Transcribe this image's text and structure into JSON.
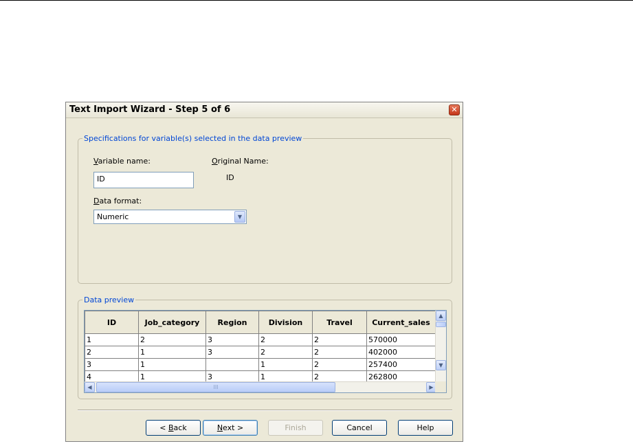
{
  "dialog": {
    "title": "Text Import Wizard - Step 5 of 6",
    "close_glyph": "✕"
  },
  "spec": {
    "legend": "Specifications for variable(s) selected in the data preview",
    "variable_name_label_prefix": "",
    "variable_name_label_u": "V",
    "variable_name_label_rest": "ariable name:",
    "variable_name_value": "ID",
    "original_name_label_u": "O",
    "original_name_label_rest": "riginal Name:",
    "original_name_value": "ID",
    "data_format_label_u": "D",
    "data_format_label_rest": "ata format:",
    "data_format_value": "Numeric"
  },
  "preview": {
    "legend": "Data preview",
    "columns": [
      "ID",
      "Job_category",
      "Region",
      "Division",
      "Travel",
      "Current_sales"
    ],
    "rows": [
      [
        "1",
        "2",
        "3",
        "2",
        "2",
        "570000"
      ],
      [
        "2",
        "1",
        "3",
        "2",
        "2",
        "402000"
      ],
      [
        "3",
        "1",
        "",
        "1",
        "2",
        "257400"
      ],
      [
        "4",
        "1",
        "3",
        "1",
        "2",
        "262800"
      ]
    ],
    "hscroll_grip": "III"
  },
  "buttons": {
    "back_prefix": "< ",
    "back_u": "B",
    "back_rest": "ack",
    "next_u": "N",
    "next_rest": "ext >",
    "finish": "Finish",
    "cancel": "Cancel",
    "help": "Help"
  },
  "icons": {
    "dropdown": "▼",
    "scroll_up": "▲",
    "scroll_down": "▼",
    "scroll_left": "◀",
    "scroll_right": "▶"
  }
}
